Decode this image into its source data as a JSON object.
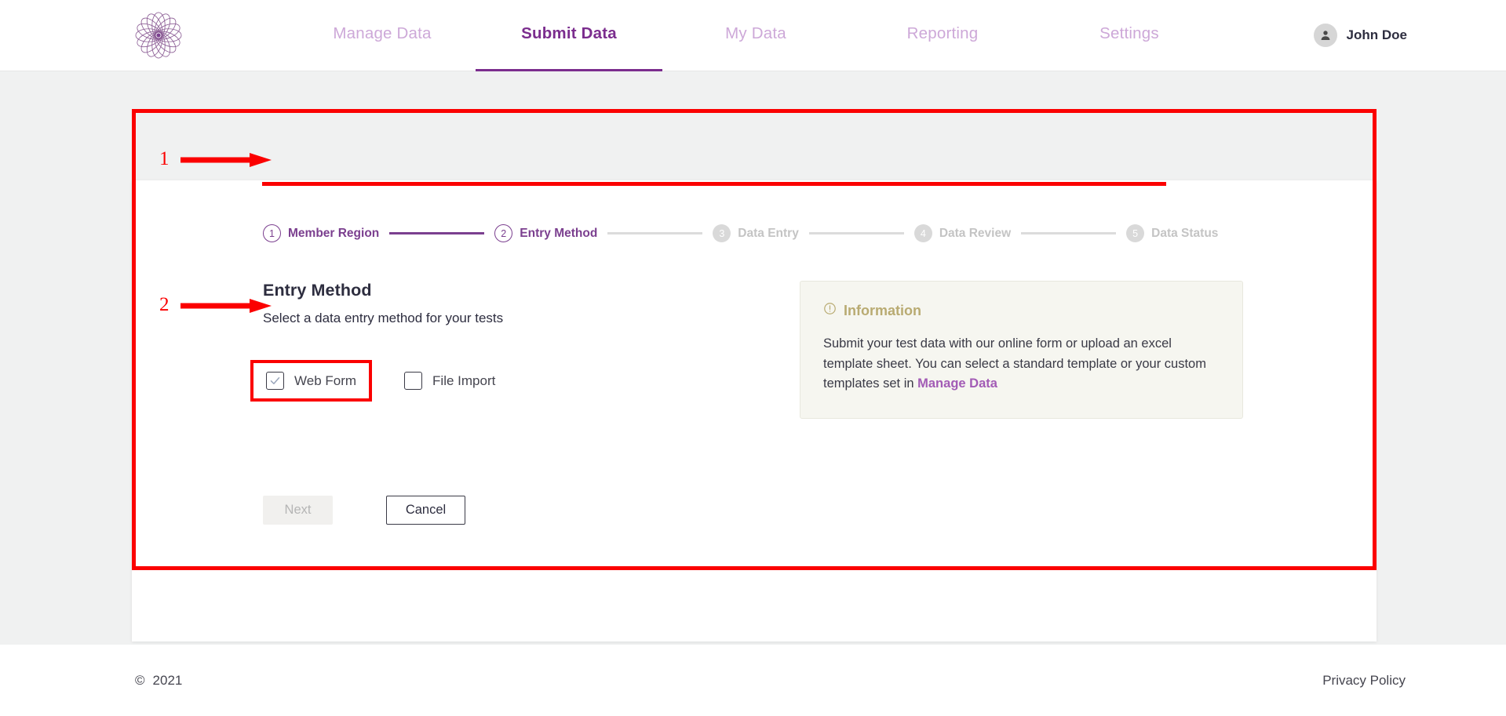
{
  "header": {
    "logo_icon": "flower-mandala-logo",
    "nav": [
      {
        "label": "Manage Data",
        "active": false
      },
      {
        "label": "Submit Data",
        "active": true
      },
      {
        "label": "My Data",
        "active": false
      },
      {
        "label": "Reporting",
        "active": false
      },
      {
        "label": "Settings",
        "active": false
      }
    ],
    "user": {
      "name": "John Doe",
      "avatar_icon": "person-icon"
    }
  },
  "stepper": {
    "steps": [
      {
        "number": "1",
        "label": "Member Region",
        "state": "done"
      },
      {
        "number": "2",
        "label": "Entry Method",
        "state": "current"
      },
      {
        "number": "3",
        "label": "Data Entry",
        "state": "pending"
      },
      {
        "number": "4",
        "label": "Data Review",
        "state": "pending"
      },
      {
        "number": "5",
        "label": "Data Status",
        "state": "pending"
      }
    ],
    "connectors": [
      "filled",
      "empty",
      "empty",
      "empty"
    ]
  },
  "form": {
    "title": "Entry Method",
    "subtitle": "Select a data entry method for your tests",
    "options": [
      {
        "label": "Web Form",
        "checked": true,
        "check_icon": "checkmark-icon"
      },
      {
        "label": "File Import",
        "checked": false
      }
    ],
    "buttons": {
      "next": "Next",
      "cancel": "Cancel"
    }
  },
  "info_panel": {
    "icon": "exclamation-circle-icon",
    "title": "Information",
    "body_before_link": "Submit your test data with our online form or upload an excel template sheet. You can select a standard template or your custom templates set in ",
    "link_text": "Manage Data"
  },
  "footer": {
    "copyright_symbol": "©",
    "year": "2021",
    "privacy_policy": "Privacy Policy"
  },
  "annotations": [
    {
      "number": "1",
      "target": "stepper"
    },
    {
      "number": "2",
      "target": "web-form-option"
    }
  ],
  "colors": {
    "brand_purple": "#7b2d8e",
    "nav_inactive": "#cda8d8",
    "step_pending": "#c4c4c4",
    "info_title": "#b9ab72",
    "info_bg": "#f6f6f0",
    "annotation_red": "#fb0000",
    "page_bg": "#f0f1f1"
  }
}
